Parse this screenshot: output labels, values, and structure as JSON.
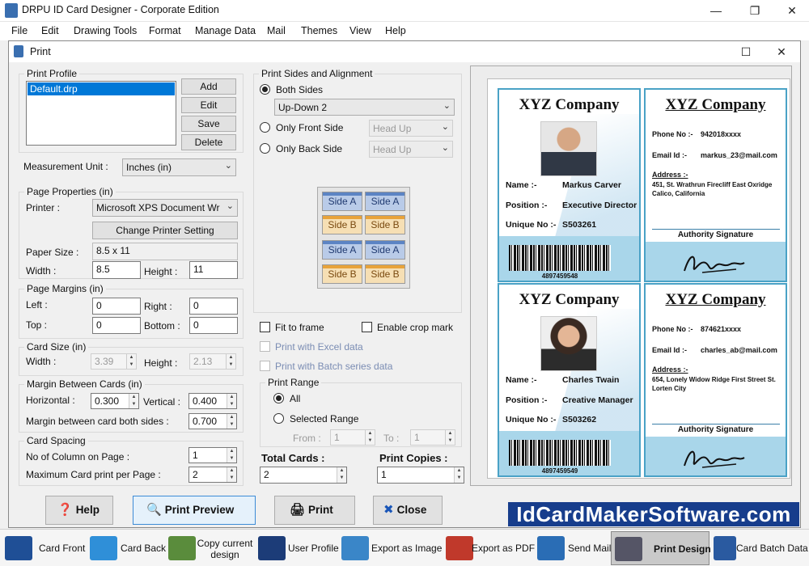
{
  "app": {
    "title": "DRPU ID Card Designer - Corporate Edition",
    "minimize": "—",
    "maximize": "❐",
    "close": "✕"
  },
  "menu": [
    "File",
    "Edit",
    "Drawing Tools",
    "Format",
    "Manage Data",
    "Mail",
    "Themes",
    "View",
    "Help"
  ],
  "dialog": {
    "title": "Print",
    "maximize": "☐",
    "close": "✕"
  },
  "print_profile": {
    "label": "Print Profile",
    "items": [
      "Default.drp"
    ],
    "buttons": [
      "Add",
      "Edit",
      "Save",
      "Delete"
    ]
  },
  "measurement": {
    "label": "Measurement Unit :",
    "value": "Inches (in)"
  },
  "page_properties": {
    "label": "Page Properties (in)",
    "printer_label": "Printer :",
    "printer_value": "Microsoft XPS Document Wr",
    "change_printer": "Change Printer Setting",
    "paper_size_label": "Paper Size :",
    "paper_size_value": "8.5 x 11",
    "width_label": "Width :",
    "width_value": "8.5",
    "height_label": "Height :",
    "height_value": "11"
  },
  "page_margins": {
    "label": "Page Margins (in)",
    "left_label": "Left :",
    "left_value": "0",
    "right_label": "Right :",
    "right_value": "0",
    "top_label": "Top :",
    "top_value": "0",
    "bottom_label": "Bottom :",
    "bottom_value": "0"
  },
  "card_size": {
    "label": "Card Size (in)",
    "width_label": "Width :",
    "width_value": "3.39",
    "height_label": "Height :",
    "height_value": "2.13"
  },
  "margin_between": {
    "label": "Margin Between Cards (in)",
    "horizontal_label": "Horizontal :",
    "horizontal_value": "0.300",
    "vertical_label": "Vertical :",
    "vertical_value": "0.400",
    "both_label": "Margin between card both sides :",
    "both_value": "0.700"
  },
  "card_spacing": {
    "label": "Card Spacing",
    "columns_label": "No of Column on Page :",
    "columns_value": "1",
    "max_label": "Maximum Card print per Page :",
    "max_value": "2"
  },
  "sides": {
    "label": "Print Sides and Alignment",
    "both_label": "Both Sides",
    "both_value": "Up-Down 2",
    "front_label": "Only Front Side",
    "front_value": "Head Up",
    "back_label": "Only Back Side",
    "back_value": "Head Up",
    "tile_a": "Side A",
    "tile_b": "Side B"
  },
  "options": {
    "fit_to_frame": "Fit to frame",
    "enable_crop": "Enable crop mark",
    "excel": "Print with Excel data",
    "batch": "Print with Batch series data"
  },
  "print_range": {
    "label": "Print Range",
    "all": "All",
    "selected": "Selected Range",
    "from_label": "From :",
    "from_value": "1",
    "to_label": "To :",
    "to_value": "1"
  },
  "totals": {
    "total_cards_label": "Total Cards :",
    "total_cards_value": "2",
    "print_copies_label": "Print Copies :",
    "print_copies_value": "1"
  },
  "cards": [
    {
      "company": "XYZ Company",
      "name_label": "Name :-",
      "name": "Markus Carver",
      "position_label": "Position :-",
      "position": "Executive Director",
      "unique_label": "Unique No :-",
      "unique": "S503261",
      "barcode": "4897459548",
      "phone_label": "Phone No :-",
      "phone": "942018xxxx",
      "email_label": "Email Id :-",
      "email": "markus_23@mail.com",
      "address_label": "Address :-",
      "address": "451, St. Wrathrun Firecliff East Oxridge Calico, California",
      "signature_label": "Authority Signature"
    },
    {
      "company": "XYZ Company",
      "name_label": "Name :-",
      "name": "Charles Twain",
      "position_label": "Position :-",
      "position": "Creative Manager",
      "unique_label": "Unique No :-",
      "unique": "S503262",
      "barcode": "4897459549",
      "phone_label": "Phone No :-",
      "phone": "874621xxxx",
      "email_label": "Email Id :-",
      "email": "charles_ab@mail.com",
      "address_label": "Address :-",
      "address": "654, Lonely Widow Ridge First Street St. Lorten City",
      "signature_label": "Authority Signature"
    }
  ],
  "buttons": {
    "help": "Help",
    "print_preview": "Print Preview",
    "print": "Print",
    "close": "Close"
  },
  "brand": "IdCardMakerSoftware.com",
  "toolbar": [
    {
      "label": "Card Front",
      "icon": "card-front-icon"
    },
    {
      "label": "Card Back",
      "icon": "card-back-icon"
    },
    {
      "label": "Copy current design",
      "icon": "copy-design-icon"
    },
    {
      "label": "User Profile",
      "icon": "user-profile-icon"
    },
    {
      "label": "Export as Image",
      "icon": "export-image-icon"
    },
    {
      "label": "Export as PDF",
      "icon": "export-pdf-icon"
    },
    {
      "label": "Send Mail",
      "icon": "send-mail-icon"
    },
    {
      "label": "Print Design",
      "icon": "printer-icon"
    },
    {
      "label": "Card Batch Data",
      "icon": "batch-data-icon"
    }
  ]
}
